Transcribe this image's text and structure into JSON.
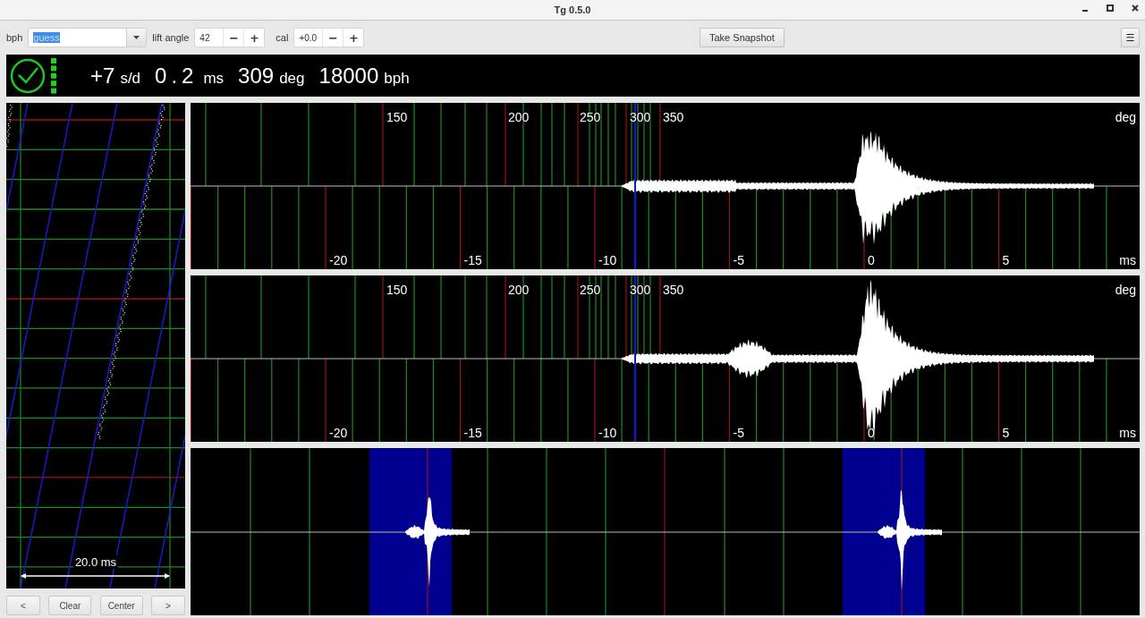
{
  "window": {
    "title": "Tg 0.5.0"
  },
  "toolbar": {
    "bph": {
      "label": "bph",
      "value": "guess",
      "text_selected": true
    },
    "lift_angle": {
      "label": "lift angle",
      "value": "42",
      "decrement": "−",
      "increment": "+"
    },
    "cal": {
      "label": "cal",
      "value": "+0.0",
      "decrement": "−",
      "increment": "+"
    },
    "snapshot_button": "Take Snapshot",
    "menu_button": "☰"
  },
  "readout": [
    {
      "value": "+7",
      "unit": "s/d"
    },
    {
      "value": "0.2",
      "unit": "ms"
    },
    {
      "value": "309",
      "unit": "deg"
    },
    {
      "value": "18000",
      "unit": "bph"
    }
  ],
  "paperstrip": {
    "scale_label": "20.0 ms",
    "buttons": [
      "<",
      "Clear",
      "Center",
      ">"
    ]
  },
  "scopes": [
    {
      "deg_labels": [
        "150",
        "200",
        "250",
        "300",
        "350"
      ],
      "deg_unit": "deg",
      "ms_labels": [
        "-20",
        "-15",
        "-10",
        "-5",
        "0",
        "5"
      ],
      "ms_unit": "ms"
    },
    {
      "deg_labels": [
        "150",
        "200",
        "250",
        "300",
        "350"
      ],
      "deg_unit": "deg",
      "ms_labels": [
        "-20",
        "-15",
        "-10",
        "-5",
        "0",
        "5"
      ],
      "ms_unit": "ms"
    }
  ]
}
